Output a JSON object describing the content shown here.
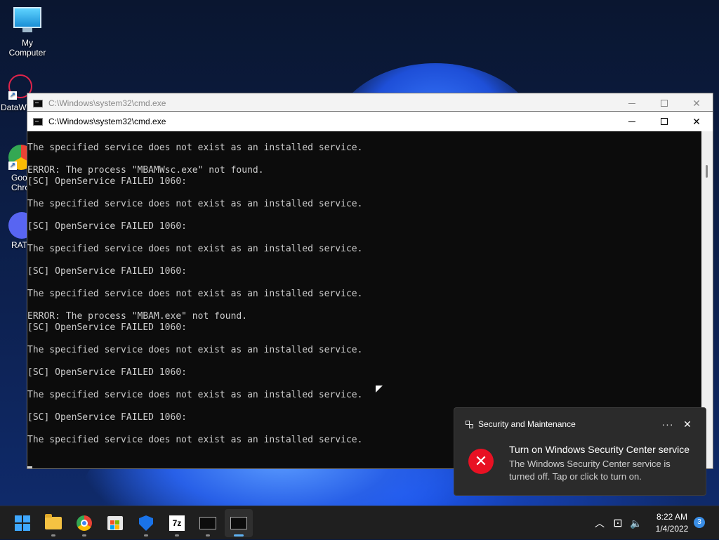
{
  "desktop": {
    "icons": [
      {
        "label": "My Computer"
      },
      {
        "label": "DataW"
      },
      {
        "label": "Goo Chro"
      },
      {
        "label": "RAT"
      }
    ]
  },
  "windows": {
    "back": {
      "title": "C:\\Windows\\system32\\cmd.exe"
    },
    "front": {
      "title": "C:\\Windows\\system32\\cmd.exe"
    },
    "controls": {
      "minimize": "–",
      "close": "✕"
    }
  },
  "console": {
    "lines": [
      "The specified service does not exist as an installed service.",
      "",
      "ERROR: The process \"MBAMWsc.exe\" not found.",
      "[SC] OpenService FAILED 1060:",
      "",
      "The specified service does not exist as an installed service.",
      "",
      "[SC] OpenService FAILED 1060:",
      "",
      "The specified service does not exist as an installed service.",
      "",
      "[SC] OpenService FAILED 1060:",
      "",
      "The specified service does not exist as an installed service.",
      "",
      "ERROR: The process \"MBAM.exe\" not found.",
      "[SC] OpenService FAILED 1060:",
      "",
      "The specified service does not exist as an installed service.",
      "",
      "[SC] OpenService FAILED 1060:",
      "",
      "The specified service does not exist as an installed service.",
      "",
      "[SC] OpenService FAILED 1060:",
      "",
      "The specified service does not exist as an installed service."
    ]
  },
  "toast": {
    "app_name": "Security and Maintenance",
    "more": "···",
    "close": "✕",
    "error_glyph": "✕",
    "title": "Turn on Windows Security Center service",
    "body": "The Windows Security Center service is turned off. Tap or click to turn on."
  },
  "taskbar": {
    "items": [
      "start-icon",
      "file-explorer-icon",
      "chrome-icon",
      "store-icon",
      "defender-icon",
      "7zip-icon",
      "cmd-icon",
      "cmd-icon"
    ],
    "sevenzip_label": "7z",
    "tray": {
      "chevron": "︿",
      "network": "⊡",
      "volume": "🔈"
    },
    "time": "8:22 AM",
    "date": "1/4/2022",
    "notifications": "3"
  }
}
